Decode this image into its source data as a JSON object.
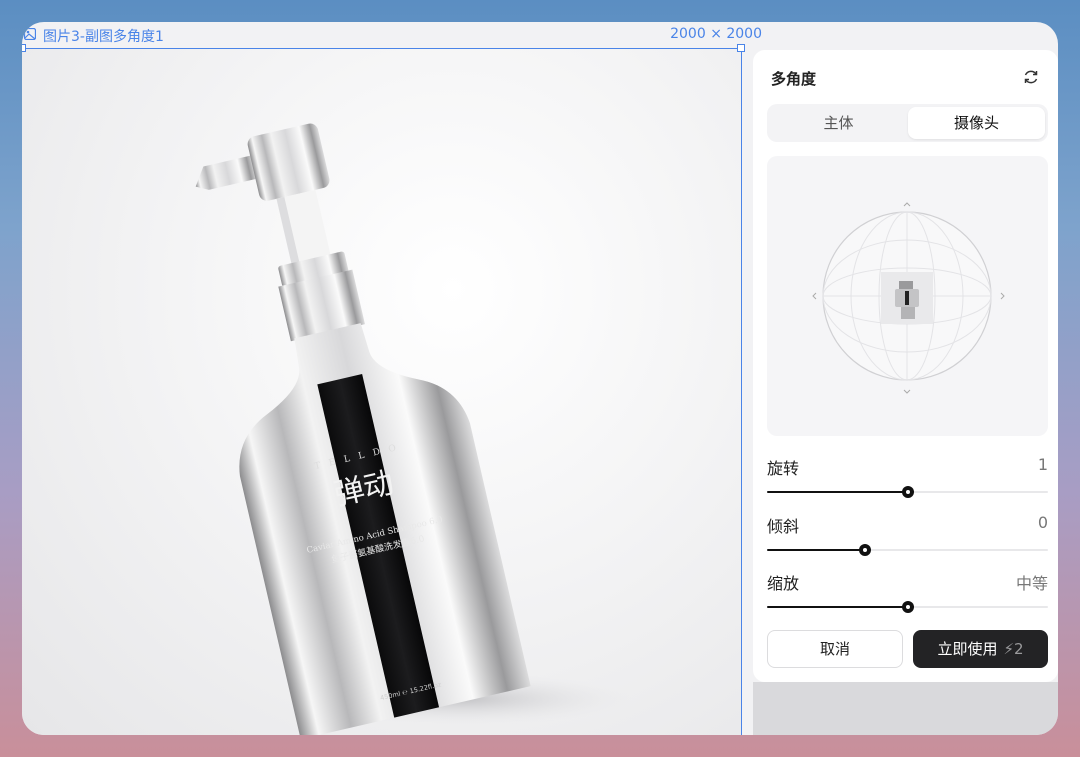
{
  "frame": {
    "name": "图片3-副图多角度1",
    "size": "2000 × 2000"
  },
  "product_label": {
    "brand": "T E L L   D O",
    "name_cn": "弹动",
    "line1": "Caviar Amino Acid Shampoo 6.0",
    "line2": "鱼子酱氨基酸洗发露6.0",
    "volume": "450ml ℮ 15.22fl.oz"
  },
  "panel": {
    "title": "多角度",
    "tabs": [
      {
        "label": "主体",
        "active": false
      },
      {
        "label": "摄像头",
        "active": true
      }
    ],
    "controls": [
      {
        "label": "旋转",
        "value": "1",
        "level": 0.5
      },
      {
        "label": "倾斜",
        "value": "0",
        "level": 0.35
      },
      {
        "label": "缩放",
        "value": "中等",
        "level": 0.5
      }
    ],
    "cancel_label": "取消",
    "apply_label": "立即使用",
    "apply_cost": "2"
  },
  "colors": {
    "selection": "#4a84e8",
    "primary_button": "#232325"
  }
}
